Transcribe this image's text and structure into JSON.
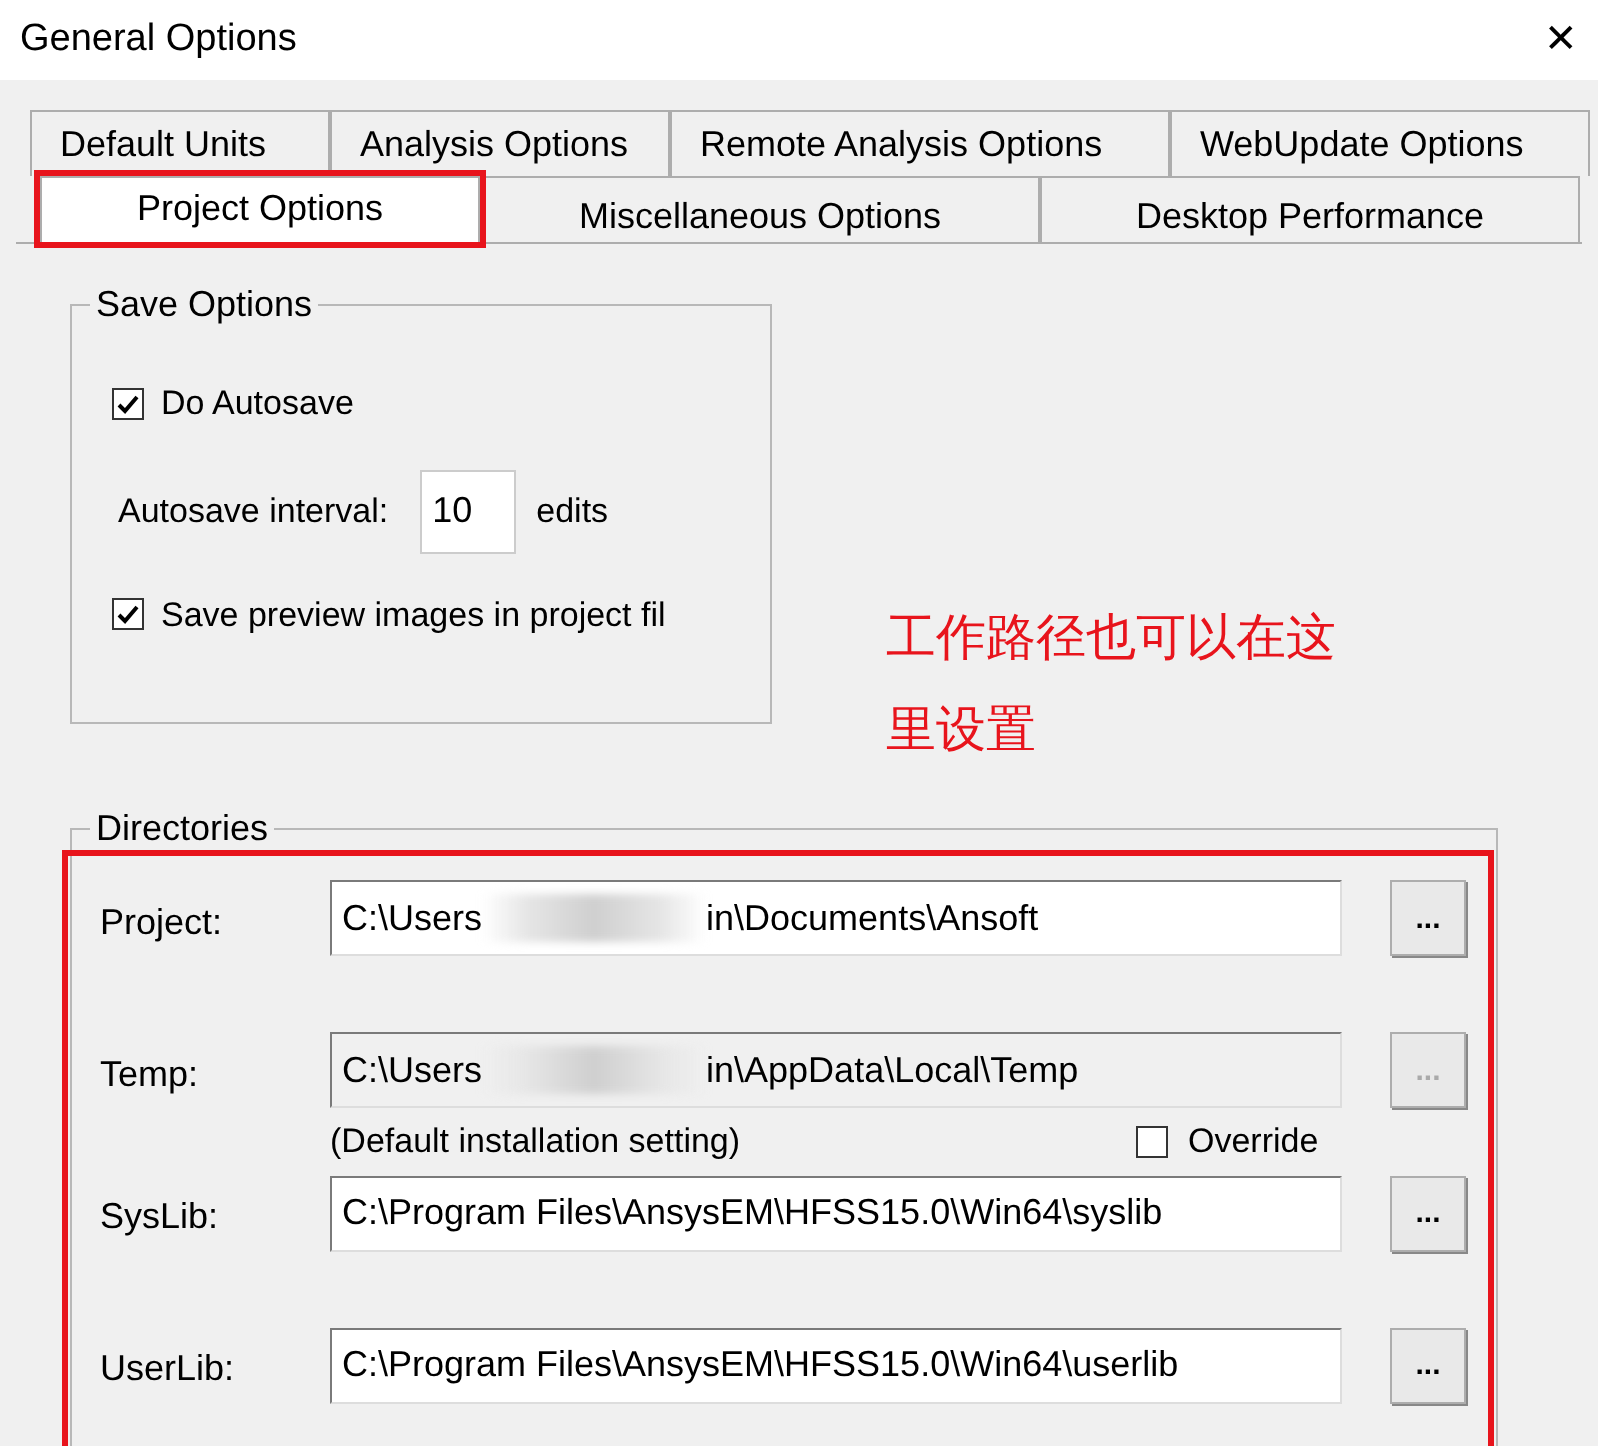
{
  "window": {
    "title": "General Options",
    "close": "✕"
  },
  "tab_rows": [
    [
      {
        "label": "Default Units",
        "selected": false
      },
      {
        "label": "Analysis Options",
        "selected": false
      },
      {
        "label": "Remote Analysis Options",
        "selected": false
      },
      {
        "label": "WebUpdate Options",
        "selected": false
      }
    ],
    [
      {
        "label": "Project Options",
        "selected": true,
        "highlighted": true
      },
      {
        "label": "Miscellaneous Options",
        "selected": false,
        "highlighted": false
      },
      {
        "label": "Desktop Performance",
        "selected": false,
        "highlighted": false
      }
    ]
  ],
  "save_options": {
    "title": "Save Options",
    "autosave": {
      "label": "Do Autosave",
      "checked": true
    },
    "interval": {
      "label": "Autosave interval:",
      "value": "10",
      "unit": "edits"
    },
    "preview": {
      "label": "Save preview images in project fil",
      "checked": true
    }
  },
  "annotation": {
    "text": "工作路径也可以在这里设置"
  },
  "directories": {
    "title": "Directories",
    "highlighted": true,
    "rows": [
      {
        "label": "Project:",
        "value_start": "C:\\Users",
        "value_end": "in\\Documents\\Ansoft",
        "disabled": false,
        "browse": "..."
      },
      {
        "label": "Temp:",
        "value_start": "C:\\Users",
        "value_end": "in\\AppData\\Local\\Temp",
        "disabled": true,
        "browse": "...",
        "note": "(Default installation setting)",
        "override": {
          "label": "Override",
          "checked": false
        }
      },
      {
        "label": "SysLib:",
        "value_start": "C:\\Program Files\\AnsysEM\\HFSS15.0\\Win64\\syslib",
        "disabled": false,
        "browse": "..."
      },
      {
        "label": "UserLib:",
        "value_start": "C:\\Program Files\\AnsysEM\\HFSS15.0\\Win64\\userlib",
        "disabled": false,
        "browse": "..."
      }
    ]
  }
}
